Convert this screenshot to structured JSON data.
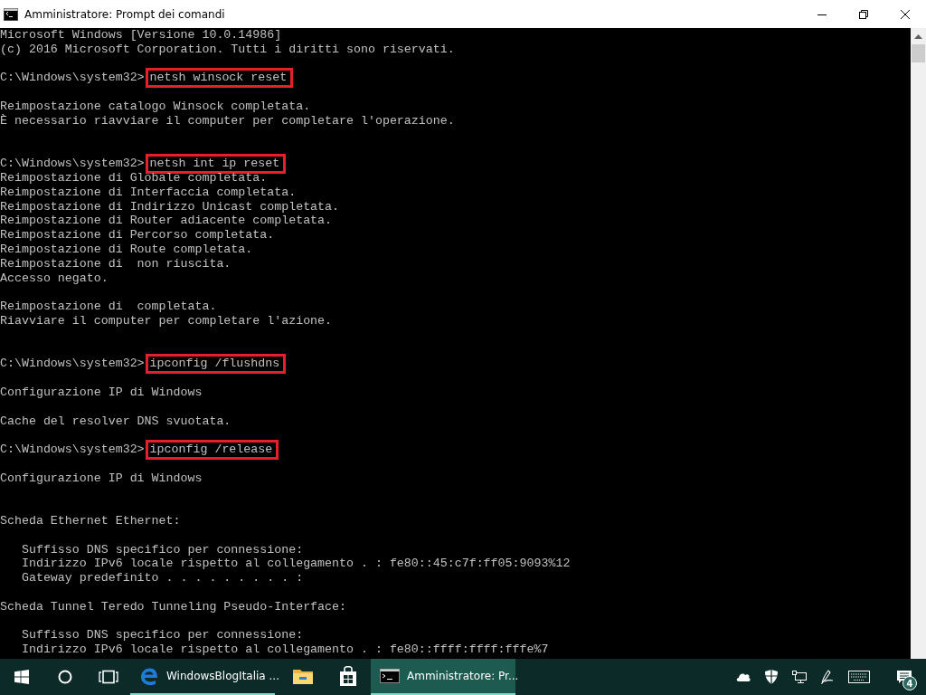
{
  "window": {
    "title": "Amministratore: Prompt dei comandi"
  },
  "console": {
    "lines": [
      {
        "kind": "text",
        "text": "Microsoft Windows [Versione 10.0.14986]"
      },
      {
        "kind": "text",
        "text": "(c) 2016 Microsoft Corporation. Tutti i diritti sono riservati."
      },
      {
        "kind": "blank"
      },
      {
        "kind": "command",
        "prompt": "C:\\Windows\\system32>",
        "command": "netsh winsock reset",
        "highlighted": true
      },
      {
        "kind": "blank"
      },
      {
        "kind": "text",
        "text": "Reimpostazione catalogo Winsock completata."
      },
      {
        "kind": "text",
        "text": "È necessario riavviare il computer per completare l'operazione."
      },
      {
        "kind": "blank"
      },
      {
        "kind": "blank"
      },
      {
        "kind": "command",
        "prompt": "C:\\Windows\\system32>",
        "command": "netsh int ip reset",
        "highlighted": true
      },
      {
        "kind": "text",
        "text": "Reimpostazione di Globale completata."
      },
      {
        "kind": "text",
        "text": "Reimpostazione di Interfaccia completata."
      },
      {
        "kind": "text",
        "text": "Reimpostazione di Indirizzo Unicast completata."
      },
      {
        "kind": "text",
        "text": "Reimpostazione di Router adiacente completata."
      },
      {
        "kind": "text",
        "text": "Reimpostazione di Percorso completata."
      },
      {
        "kind": "text",
        "text": "Reimpostazione di Route completata."
      },
      {
        "kind": "text",
        "text": "Reimpostazione di  non riuscita."
      },
      {
        "kind": "text",
        "text": "Accesso negato."
      },
      {
        "kind": "blank"
      },
      {
        "kind": "text",
        "text": "Reimpostazione di  completata."
      },
      {
        "kind": "text",
        "text": "Riavviare il computer per completare l'azione."
      },
      {
        "kind": "blank"
      },
      {
        "kind": "blank"
      },
      {
        "kind": "command",
        "prompt": "C:\\Windows\\system32>",
        "command": "ipconfig /flushdns",
        "highlighted": true
      },
      {
        "kind": "blank"
      },
      {
        "kind": "text",
        "text": "Configurazione IP di Windows"
      },
      {
        "kind": "blank"
      },
      {
        "kind": "text",
        "text": "Cache del resolver DNS svuotata."
      },
      {
        "kind": "blank"
      },
      {
        "kind": "command",
        "prompt": "C:\\Windows\\system32>",
        "command": "ipconfig /release",
        "highlighted": true
      },
      {
        "kind": "blank"
      },
      {
        "kind": "text",
        "text": "Configurazione IP di Windows"
      },
      {
        "kind": "blank"
      },
      {
        "kind": "blank"
      },
      {
        "kind": "text",
        "text": "Scheda Ethernet Ethernet:"
      },
      {
        "kind": "blank"
      },
      {
        "kind": "text",
        "text": "   Suffisso DNS specifico per connessione:"
      },
      {
        "kind": "text",
        "text": "   Indirizzo IPv6 locale rispetto al collegamento . : fe80::45:c7f:ff05:9093%12"
      },
      {
        "kind": "text",
        "text": "   Gateway predefinito . . . . . . . . . :"
      },
      {
        "kind": "blank"
      },
      {
        "kind": "text",
        "text": "Scheda Tunnel Teredo Tunneling Pseudo-Interface:"
      },
      {
        "kind": "blank"
      },
      {
        "kind": "text",
        "text": "   Suffisso DNS specifico per connessione:"
      },
      {
        "kind": "text",
        "text": "   Indirizzo IPv6 locale rispetto al collegamento . : fe80::ffff:ffff:fffe%7"
      }
    ]
  },
  "taskbar": {
    "apps": [
      {
        "kind": "browser",
        "label": "WindowsBlogItalia ...",
        "running": true,
        "selected": false
      },
      {
        "kind": "folder",
        "running": false,
        "selected": false
      },
      {
        "kind": "store",
        "running": false,
        "selected": false
      },
      {
        "kind": "console",
        "label": "Amministratore: Pr...",
        "running": true,
        "selected": true
      }
    ],
    "notifications": {
      "count": "4"
    }
  }
}
